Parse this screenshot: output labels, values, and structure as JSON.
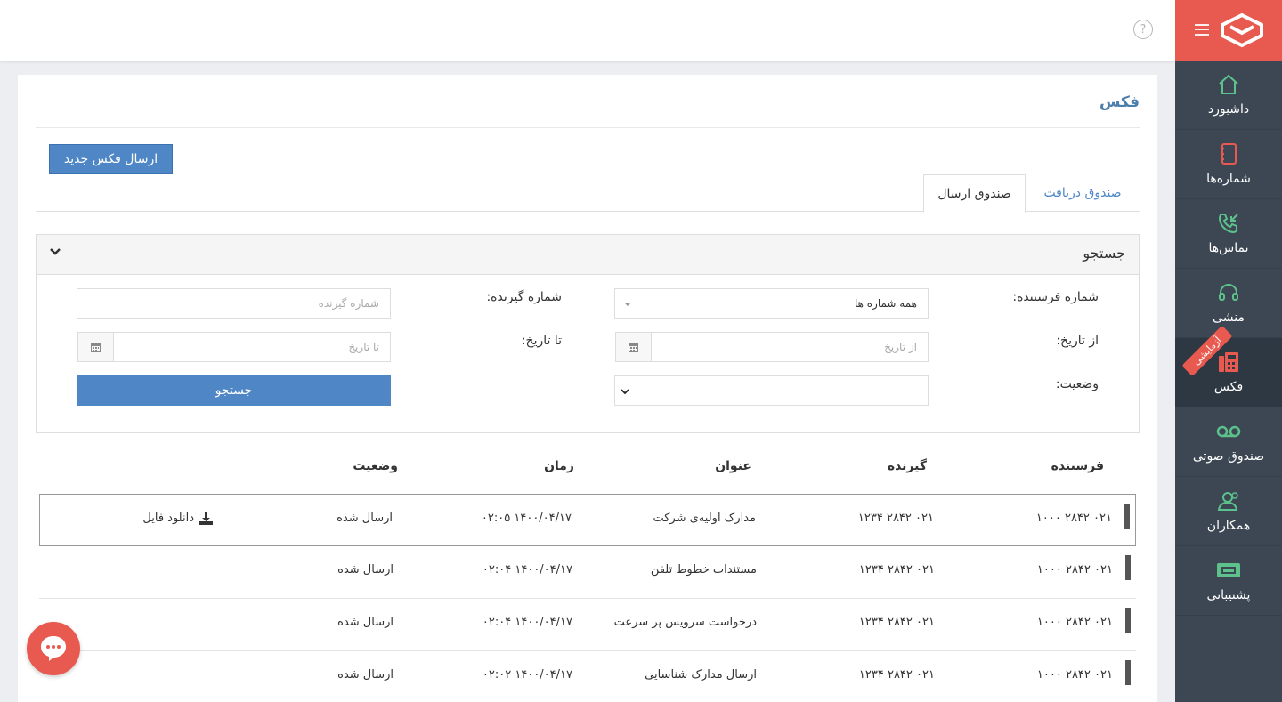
{
  "page_title": "فکس",
  "new_fax_button": "ارسال فکس جدید",
  "tabs": [
    {
      "label": "صندوق دریافت"
    },
    {
      "label": "صندوق ارسال"
    }
  ],
  "search": {
    "title": "جستجو",
    "sender_label": "شماره فرستنده:",
    "sender_value": "همه شماره ها",
    "receiver_label": "شماره گیرنده:",
    "receiver_placeholder": "شماره گیرنده",
    "from_date_label": "از تاریخ:",
    "from_date_placeholder": "از تاریخ",
    "to_date_label": "تا تاریخ:",
    "to_date_placeholder": "تا تاریخ",
    "status_label": "وضعیت:",
    "search_button": "جستجو"
  },
  "table": {
    "headers": {
      "sender": "فرستنده",
      "receiver": "گیرنده",
      "subject": "عنوان",
      "time": "زمان",
      "status": "وضعیت"
    },
    "rows": [
      {
        "sender": "۰۲۱ ۲۸۴۲ ۱۰۰۰",
        "receiver": "۰۲۱ ۲۸۴۲ ۱۲۳۴",
        "subject": "مدارک اولیه‌ی شرکت",
        "time": "۱۴۰۰/۰۴/۱۷ ۰۲:۰۵",
        "status": "ارسال شده",
        "download": "دانلود فایل"
      },
      {
        "sender": "۰۲۱ ۲۸۴۲ ۱۰۰۰",
        "receiver": "۰۲۱ ۲۸۴۲ ۱۲۳۴",
        "subject": "مستندات خطوط تلفن",
        "time": "۱۴۰۰/۰۴/۱۷ ۰۲:۰۴",
        "status": "ارسال شده"
      },
      {
        "sender": "۰۲۱ ۲۸۴۲ ۱۰۰۰",
        "receiver": "۰۲۱ ۲۸۴۲ ۱۲۳۴",
        "subject": "درخواست سرویس پر سرعت",
        "time": "۱۴۰۰/۰۴/۱۷ ۰۲:۰۴",
        "status": "ارسال شده"
      },
      {
        "sender": "۰۲۱ ۲۸۴۲ ۱۰۰۰",
        "receiver": "۰۲۱ ۲۸۴۲ ۱۲۳۴",
        "subject": "ارسال مدارک شناسایی",
        "time": "۱۴۰۰/۰۴/۱۷ ۰۲:۰۲",
        "status": "ارسال شده"
      }
    ]
  },
  "sidebar": {
    "items": [
      {
        "label": "داشبورد",
        "icon": "home-icon"
      },
      {
        "label": "شماره‌ها",
        "icon": "notebook-icon"
      },
      {
        "label": "تماس‌ها",
        "icon": "phone-incoming-icon"
      },
      {
        "label": "منشی",
        "icon": "headset-icon"
      },
      {
        "label": "فکس",
        "icon": "fax-icon",
        "badge": "آزمایشی"
      },
      {
        "label": "صندوق صوتی",
        "icon": "voicemail-icon"
      },
      {
        "label": "همکاران",
        "icon": "users-icon"
      },
      {
        "label": "پشتیبانی",
        "icon": "ticket-icon"
      }
    ]
  },
  "colors": {
    "accent": "#4f86c6",
    "brand": "#e8594f",
    "sidebar": "#3c4753",
    "icon_green": "#5cc18b"
  }
}
